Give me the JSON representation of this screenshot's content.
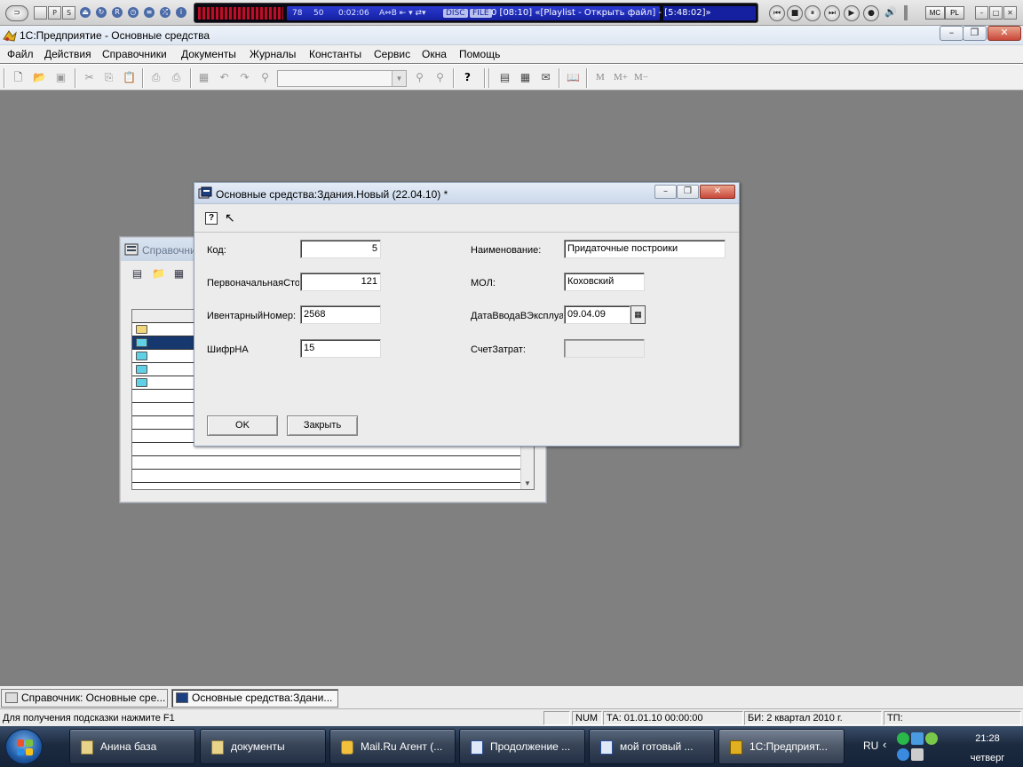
{
  "player": {
    "spectrum_left": "78",
    "spectrum_right": "50",
    "time": "0:02:06",
    "controls": "A⇔B ⇤ ▾ ⇄▾",
    "disc": "DISC",
    "file": "FILE",
    "track_info": "0  [08:10]  «[Playlist - Открыть файл] - [5:48:02]»",
    "mc": "MC",
    "pl": "PL"
  },
  "app": {
    "title": "1С:Предприятие - Основные средства",
    "menu": [
      "Файл",
      "Действия",
      "Справочники",
      "Документы",
      "Журналы",
      "Константы",
      "Сервис",
      "Окна",
      "Помощь"
    ],
    "toolbar_m": [
      "M",
      "M+",
      "M−"
    ]
  },
  "bg_window": {
    "title": "Справочник: Основные средства"
  },
  "dialog": {
    "title": "Основные средства:Здания.Новый (22.04.10) *",
    "fields": {
      "kod_label": "Код:",
      "kod_value": "5",
      "cost_label": "ПервоначальнаяСто",
      "cost_value": "121",
      "inv_label": "ИвентарныйНомер:",
      "inv_value": "2568",
      "shifr_label": "ШифрНА",
      "shifr_value": "15",
      "name_label": "Наименование:",
      "name_value": "Придаточные построики",
      "mol_label": "МОЛ:",
      "mol_value": "Коховский",
      "date_label": "ДатаВводаВЭксплуа",
      "date_value": "09.04.09",
      "account_label": "СчетЗатрат:",
      "account_value": ""
    },
    "ok_label": "OK",
    "close_label": "Закрыть"
  },
  "window_tabs": [
    "Справочник: Основные сре...",
    "Основные средства:Здани..."
  ],
  "statusbar": {
    "hint": "Для получения подсказки нажмите F1",
    "num": "NUM",
    "ta": "ТА: 01.01.10  00:00:00",
    "bi": "БИ: 2 квартал 2010 г.",
    "tp": "ТП:"
  },
  "taskbar": {
    "buttons": [
      "Анина база",
      "документы",
      "Mail.Ru Агент (...",
      "Продолжение ...",
      "мой готовый ...",
      "1С:Предприят..."
    ],
    "lang": "RU",
    "time": "21:28",
    "day": "четверг"
  },
  "colors": {
    "accent_start": "#1f5aa6",
    "selected_row": "#16386e",
    "close_button": "#c9483a"
  }
}
